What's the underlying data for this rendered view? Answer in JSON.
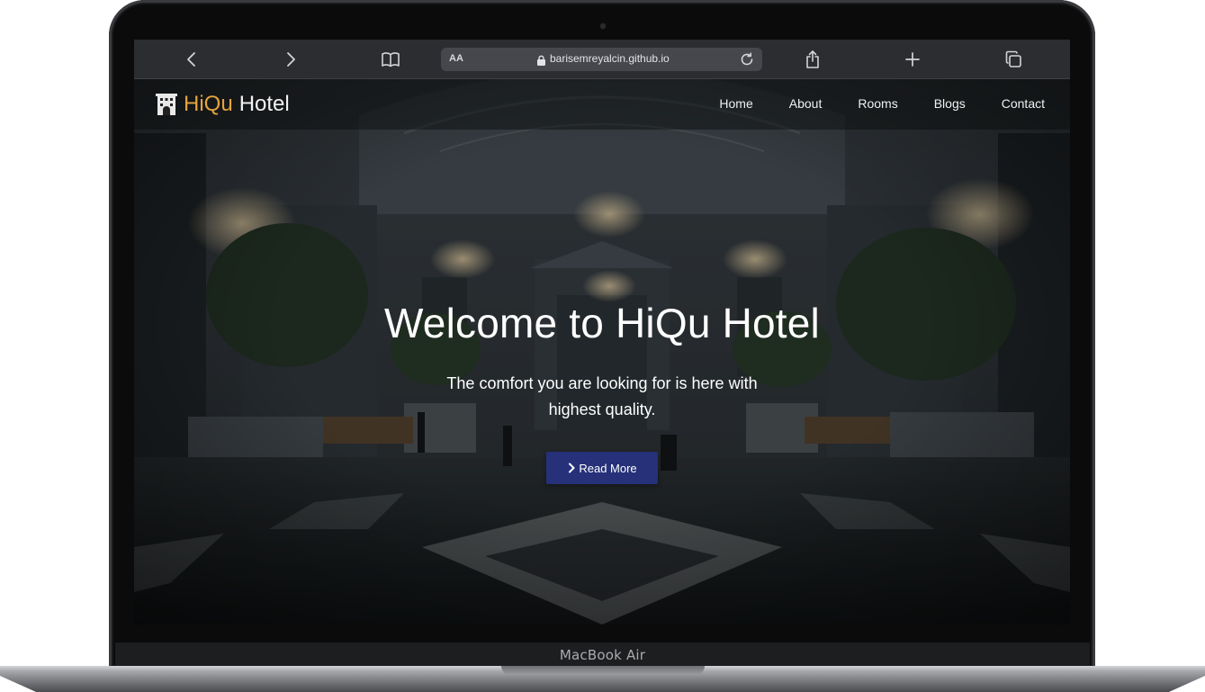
{
  "device": {
    "label": "MacBook Air"
  },
  "browser": {
    "text_size_label": "AA",
    "url": "barisemreyalcin.github.io",
    "icons": {
      "back": "chevron-left-icon",
      "forward": "chevron-right-icon",
      "bookmarks": "book-icon",
      "lock": "lock-icon",
      "reload": "reload-icon",
      "share": "share-icon",
      "new_tab": "plus-icon",
      "tabs": "tabs-icon"
    }
  },
  "site": {
    "brand": {
      "accent": "HiQu",
      "rest": "Hotel",
      "icon": "hotel-building-icon",
      "accent_color": "#e6a33e"
    },
    "nav": [
      {
        "label": "Home"
      },
      {
        "label": "About"
      },
      {
        "label": "Rooms"
      },
      {
        "label": "Blogs"
      },
      {
        "label": "Contact"
      }
    ],
    "hero": {
      "title": "Welcome to HiQu Hotel",
      "subtitle": "The comfort you are looking for is here with highest quality.",
      "button_label": "Read More",
      "button_icon": "chevron-right-icon",
      "button_color": "#26317a"
    }
  }
}
